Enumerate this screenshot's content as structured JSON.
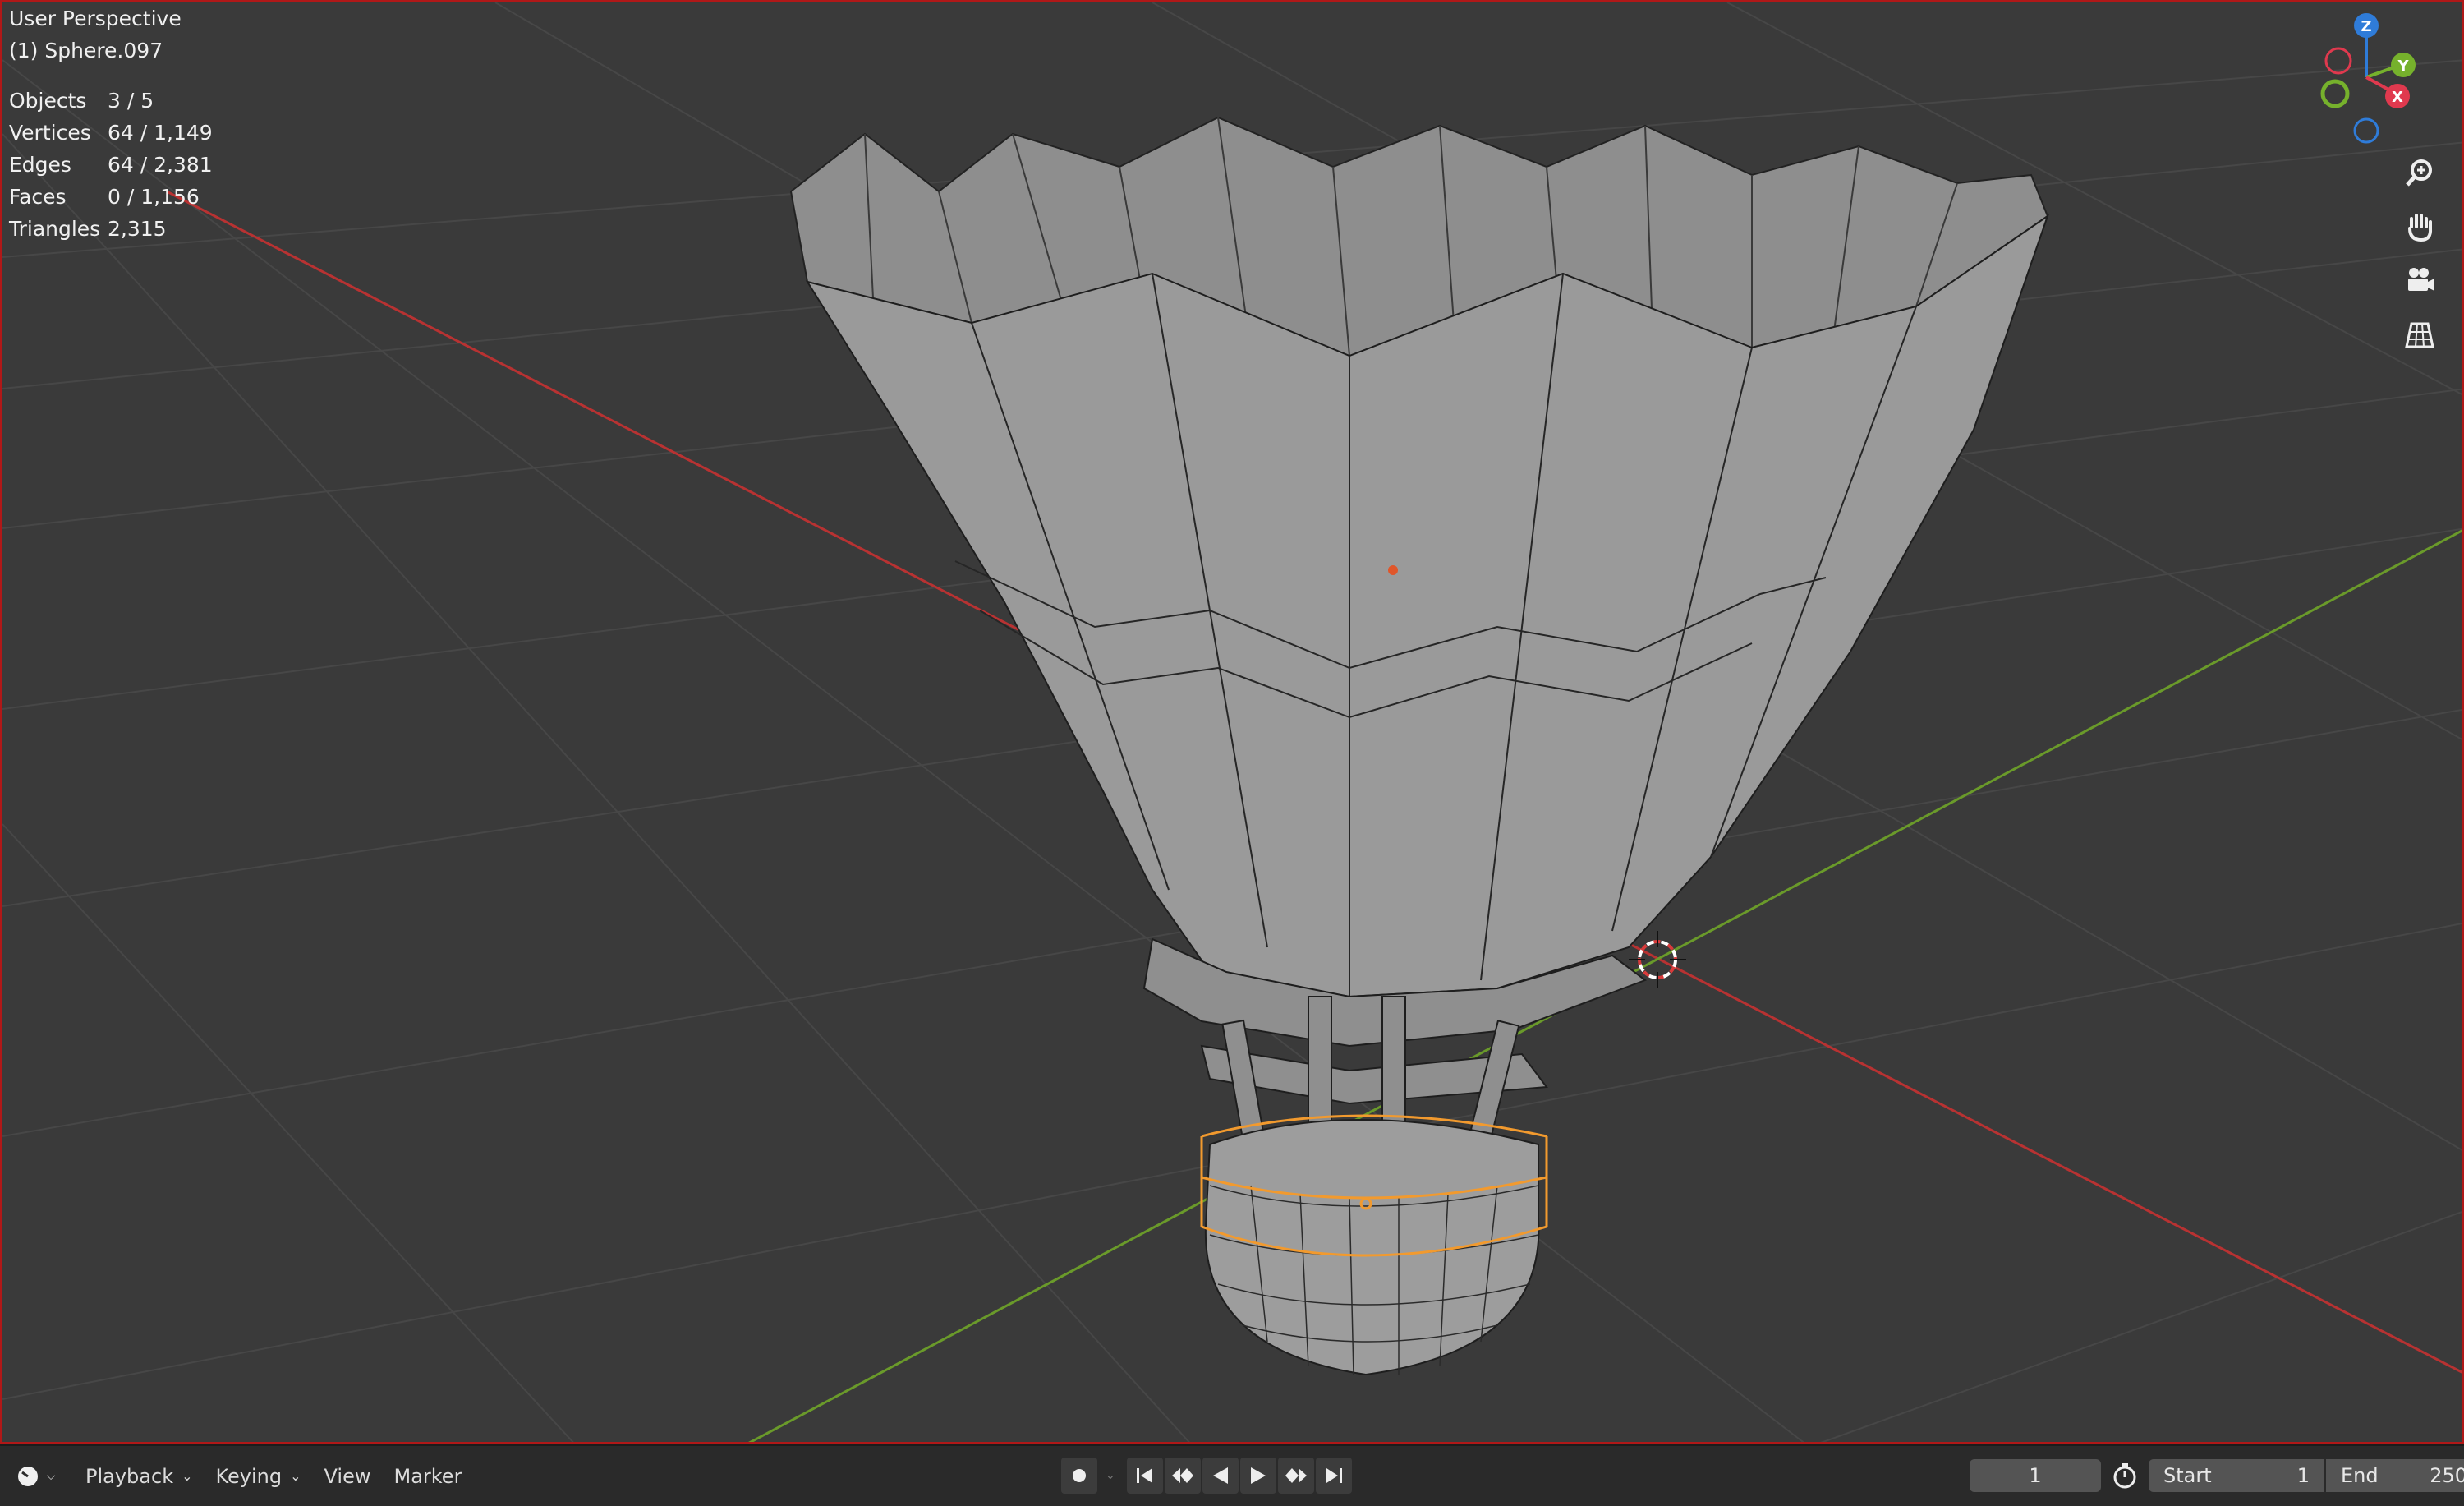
{
  "viewport": {
    "view_name": "User Perspective",
    "active_object": "(1) Sphere.097",
    "stats": [
      {
        "key": "Objects",
        "value": "3 / 5"
      },
      {
        "key": "Vertices",
        "value": "64 / 1,149"
      },
      {
        "key": "Edges",
        "value": "64 / 2,381"
      },
      {
        "key": "Faces",
        "value": "0 / 1,156"
      },
      {
        "key": "Triangles",
        "value": "2,315"
      }
    ],
    "gizmo": {
      "z_label": "Z",
      "y_label": "Y",
      "x_label": "X",
      "colors": {
        "x": "#e0394e",
        "y": "#76b12c",
        "z": "#2f7cd9"
      }
    },
    "nav_icons": [
      "zoom-icon",
      "hand-pan-icon",
      "camera-icon",
      "grid-perspective-icon"
    ]
  },
  "timeline": {
    "menus": [
      {
        "label": "Playback"
      },
      {
        "label": "Keying"
      },
      {
        "label": "View"
      },
      {
        "label": "Marker"
      }
    ],
    "current_frame": "1",
    "start_label": "Start",
    "start_value": "1",
    "end_label": "End",
    "end_value": "250"
  },
  "colors": {
    "viewport_border": "#b01818",
    "axis_x": "#c03030",
    "axis_y": "#6a9a2a",
    "selection": "#f29a2e"
  }
}
